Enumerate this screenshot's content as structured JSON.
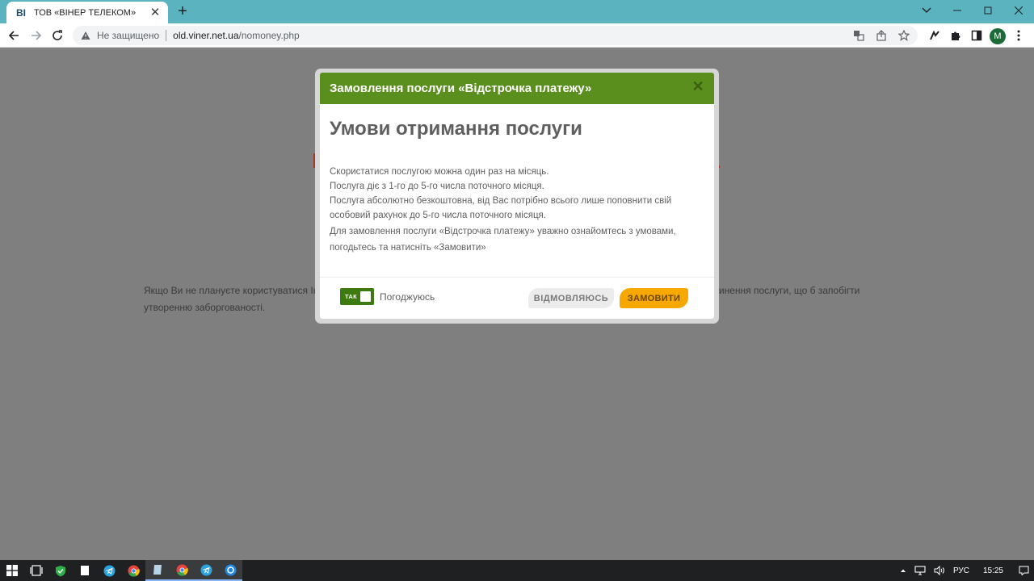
{
  "browser": {
    "tab": {
      "title": "ТОВ «ВІНЕР ТЕЛЕКОМ»",
      "favicon_text": "ВІ"
    },
    "address": {
      "security_label": "Не защищено",
      "url_host": "old.viner.net.ua",
      "url_path": "/nomoney.php"
    },
    "profile_initial": "M"
  },
  "page": {
    "text_left": "Якщо Ви не плануєте користуватися Ін",
    "text_right": "зупинення послуги, що б запобігти",
    "text_line2": "утворенню заборгованості."
  },
  "modal": {
    "title": "Замовлення послуги «Відстрочка платежу»",
    "close_symbol": "✕",
    "heading": "Умови отримання послуги",
    "body": [
      "Скористатися послугою можна один раз на місяць.",
      "Послуга діє з 1-го до 5-го числа поточного місяця.",
      "Послуга абсолютно безкоштовна, від Вас потрібно всього лише поповнити свій особовий рахунок до 5-го числа поточного місяця.",
      "Для замовлення послуги «Відстрочка платежу» уважно ознайомтесь з умовами, погодьтесь та натисніть «Замовити»"
    ],
    "toggle_label": "ТАК",
    "agree_label": "Погоджуюсь",
    "decline_button": "ВІДМОВЛЯЮСЬ",
    "order_button": "ЗАМОВИТИ"
  },
  "taskbar": {
    "language": "РУС",
    "time": "15:25"
  },
  "colors": {
    "modal_header": "#5a8f1e",
    "order_button": "#f6a800",
    "overlay": "#7f7f7f",
    "tabbar": "#5ab3bf"
  }
}
